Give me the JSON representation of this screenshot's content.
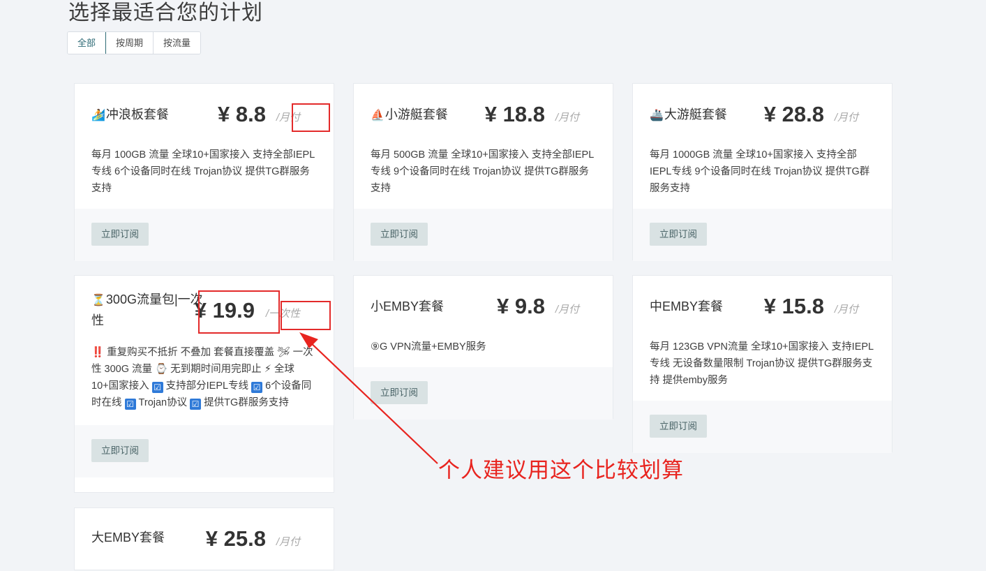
{
  "page": {
    "title": "选择最适合您的计划"
  },
  "filters": [
    {
      "label": "全部",
      "active": true
    },
    {
      "label": "按周期",
      "active": false
    },
    {
      "label": "按流量",
      "active": false
    }
  ],
  "cards": [
    {
      "icon": "🏄",
      "name": "冲浪板套餐",
      "price": "¥ 8.8",
      "period": "/月付",
      "desc": "每月 100GB 流量 全球10+国家接入 支持全部IEPL专线 6个设备同时在线 Trojan协议 提供TG群服务支持",
      "button": "立即订阅"
    },
    {
      "icon": "⛵",
      "name": "小游艇套餐",
      "price": "¥ 18.8",
      "period": "/月付",
      "desc": "每月 500GB 流量 全球10+国家接入 支持全部IEPL专线 9个设备同时在线 Trojan协议 提供TG群服务支持",
      "button": "立即订阅"
    },
    {
      "icon": "🚢",
      "name": "大游艇套餐",
      "price": "¥ 28.8",
      "period": "/月付",
      "desc": "每月 1000GB 流量 全球10+国家接入 支持全部IEPL专线 9个设备同时在线 Trojan协议 提供TG群服务支持",
      "button": "立即订阅"
    },
    {
      "icon": "⏳",
      "name": "300G流量包|一次性",
      "price": "¥ 19.9",
      "period": "/一次性",
      "desc_parts": [
        "‼️",
        " 重复购买不抵折 不叠加 套餐直接覆盖 ",
        "🛩",
        " 一次性 300G 流量 ",
        "⌚",
        " 无到期时间用完即止 ",
        "⚡",
        " 全球10+国家接入 ",
        "☑",
        " 支持部分IEPL专线 ",
        "☑",
        " 6个设备同时在线 ",
        "☑",
        " Trojan协议 ",
        "☑",
        " 提供TG群服务支持"
      ],
      "button": "立即订阅"
    },
    {
      "icon": "",
      "name": "小EMBY套餐",
      "price": "¥ 9.8",
      "period": "/月付",
      "desc": "⑨G VPN流量+EMBY服务",
      "button": "立即订阅"
    },
    {
      "icon": "",
      "name": "中EMBY套餐",
      "price": "¥ 15.8",
      "period": "/月付",
      "desc": "每月 123GB VPN流量 全球10+国家接入 支持IEPL专线 无设备数量限制 Trojan协议 提供TG群服务支持 提供emby服务",
      "button": "立即订阅"
    },
    {
      "icon": "",
      "name": "大EMBY套餐",
      "price": "¥ 25.8",
      "period": "/月付"
    }
  ],
  "annotation": {
    "text": "个人建议用这个比较划算"
  }
}
